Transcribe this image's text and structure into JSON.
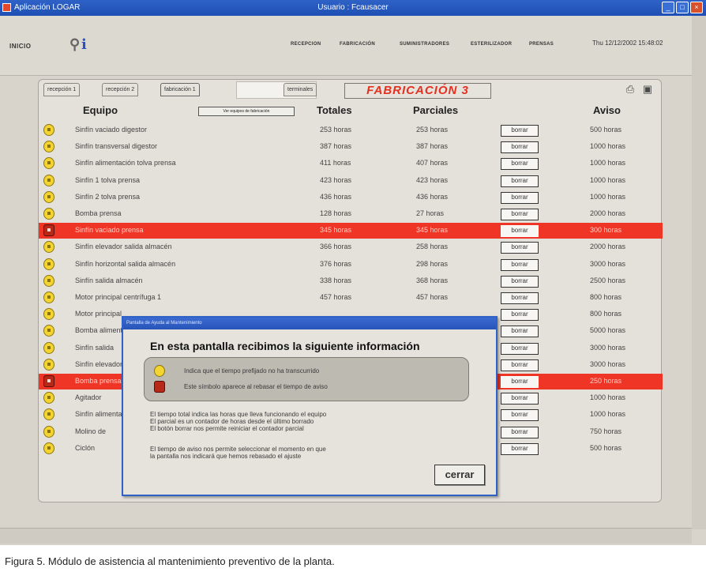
{
  "window": {
    "app_title": "Aplicación LOGAR",
    "title": "Usuario : Fcausacer",
    "controls": [
      "_",
      "□",
      "×"
    ]
  },
  "menubar": {
    "home": "INICIO",
    "icons": [
      "pin-icon",
      "info-icon"
    ],
    "items": [
      "RECEPCION",
      "FABRICACIÓN",
      "SUMINISTRADORES",
      "ESTERILIZADOR",
      "PRENSAS"
    ],
    "datetime": "Thu 12/12/2002 15:48:02"
  },
  "panel": {
    "tabs": [
      "recepción 1",
      "recepción 2",
      "fabricación 1",
      "terminales"
    ],
    "title": "FABRICACIÓN 3",
    "title_color": "#e43020",
    "icons": [
      "printer-icon",
      "save-icon"
    ],
    "columns": {
      "equipo": "Equipo",
      "equipo_button": "Ver equipos de fabricación",
      "totales": "Totales",
      "parciales": "Parciales",
      "aviso": "Aviso"
    },
    "reset_label": "borrar",
    "rows": [
      {
        "status": "ok",
        "equipo": "Sinfín vaciado digestor",
        "totales": "253 horas",
        "parciales": "253 horas",
        "aviso": "500 horas"
      },
      {
        "status": "ok",
        "equipo": "Sinfín transversal digestor",
        "totales": "387 horas",
        "parciales": "387 horas",
        "aviso": "1000 horas"
      },
      {
        "status": "ok",
        "equipo": "Sinfín alimentación tolva prensa",
        "totales": "411 horas",
        "parciales": "407 horas",
        "aviso": "1000 horas"
      },
      {
        "status": "ok",
        "equipo": "Sinfín 1 tolva prensa",
        "totales": "423 horas",
        "parciales": "423 horas",
        "aviso": "1000 horas"
      },
      {
        "status": "ok",
        "equipo": "Sinfín 2 tolva prensa",
        "totales": "436 horas",
        "parciales": "436 horas",
        "aviso": "1000 horas"
      },
      {
        "status": "ok",
        "equipo": "Bomba prensa",
        "totales": "128 horas",
        "parciales": "27 horas",
        "aviso": "2000 horas"
      },
      {
        "status": "alert",
        "equipo": "Sinfín vaciado prensa",
        "totales": "345 horas",
        "parciales": "345 horas",
        "aviso": "300 horas"
      },
      {
        "status": "ok",
        "equipo": "Sinfín elevador salida almacén",
        "totales": "366 horas",
        "parciales": "258 horas",
        "aviso": "2000 horas"
      },
      {
        "status": "ok",
        "equipo": "Sinfín horizontal salida almacén",
        "totales": "376 horas",
        "parciales": "298 horas",
        "aviso": "3000 horas"
      },
      {
        "status": "ok",
        "equipo": "Sinfín salida almacén",
        "totales": "338 horas",
        "parciales": "368 horas",
        "aviso": "2500 horas"
      },
      {
        "status": "ok",
        "equipo": "Motor principal centrífuga 1",
        "totales": "457 horas",
        "parciales": "457 horas",
        "aviso": "800 horas"
      },
      {
        "status": "ok",
        "equipo": "Motor principal",
        "totales": "",
        "parciales": "",
        "aviso": "800 horas"
      },
      {
        "status": "ok",
        "equipo": "Bomba alimentación",
        "totales": "",
        "parciales": "",
        "aviso": "5000 horas"
      },
      {
        "status": "ok",
        "equipo": "Sinfín salida",
        "totales": "",
        "parciales": "",
        "aviso": "3000 horas"
      },
      {
        "status": "ok",
        "equipo": "Sinfín elevador",
        "totales": "",
        "parciales": "",
        "aviso": "3000 horas"
      },
      {
        "status": "alert",
        "equipo": "Bomba prensa",
        "totales": "",
        "parciales": "",
        "aviso": "250 horas"
      },
      {
        "status": "ok",
        "equipo": "Agitador",
        "totales": "",
        "parciales": "",
        "aviso": "1000 horas"
      },
      {
        "status": "ok",
        "equipo": "Sinfín alimentación",
        "totales": "",
        "parciales": "",
        "aviso": "1000 horas"
      },
      {
        "status": "ok",
        "equipo": "Molino de",
        "totales": "",
        "parciales": "",
        "aviso": "750 horas"
      },
      {
        "status": "ok",
        "equipo": "Ciclón",
        "totales": "",
        "parciales": "",
        "aviso": "500 horas"
      }
    ]
  },
  "dialog": {
    "title": "Pantalla de Ayuda al Mantenimiento",
    "heading": "En esta pantalla recibimos la siguiente información",
    "legend": [
      {
        "icon": "ok-status-icon",
        "text": "Indica que el tiempo prefijado no ha transcurrido"
      },
      {
        "icon": "alert-status-icon",
        "text": "Este símbolo aparece al rebasar el tiempo de aviso"
      }
    ],
    "lines": [
      "El tiempo total indica las horas que lleva funcionando el equipo",
      "El parcial es un contador de horas desde el último borrado",
      "El botón borrar nos permite reiniciar el contador parcial"
    ],
    "lines2": [
      "El tiempo de aviso nos permite seleccionar el momento en que",
      "la pantalla nos indicará que hemos rebasado el ajuste"
    ],
    "close_label": "cerrar"
  },
  "caption": "Figura 5. Módulo de asistencia al mantenimiento preventivo de la planta.",
  "colors": {
    "alert_row": "#ee3526",
    "ok_icon": "#f3d430",
    "titlebar": "#2f62c6"
  }
}
